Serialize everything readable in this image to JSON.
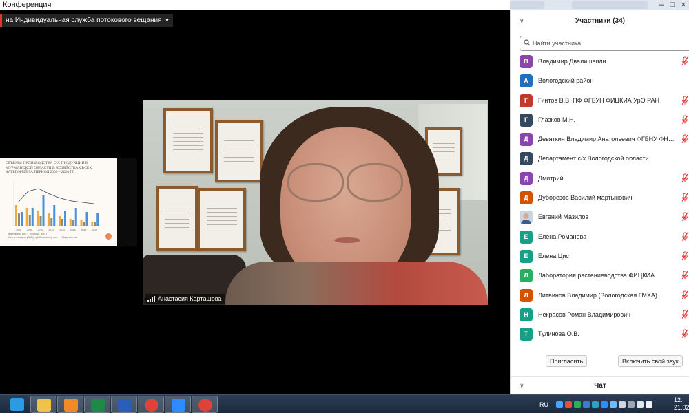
{
  "window": {
    "title": "Конференция",
    "controls": [
      "–",
      "□",
      "×"
    ]
  },
  "stream_banner": {
    "text": "на Индивидуальная служба потокового вещания",
    "caret": "▾"
  },
  "shared_slide": {
    "title": "Объемы производства с/х продукции в Мурманской области в хозяйствах всех категорий за период 2000 – 2020 гг.",
    "legend": [
      "Картофель, тыс. т",
      "Молоко, тыс. т",
      "Скот и птица на убой (в убойном весе), тыс. т",
      "Яйца, млн. шт."
    ],
    "x_labels": [
      "2000",
      "2005",
      "2010",
      "2012",
      "2014",
      "2016",
      "2018",
      "2020"
    ],
    "colors": {
      "potato": "#f2a93b",
      "milk": "#4a90d9",
      "meat": "#8a8a8a",
      "eggs": "#2c3e60"
    }
  },
  "main_video": {
    "participant_name": "Анастасия Карташова"
  },
  "participants": {
    "header_title": "Участники (34)",
    "search_placeholder": "Найти участника",
    "items": [
      {
        "initial": "В",
        "name": "Владимир Двалишвили",
        "color": "#8e44ad",
        "muted": true
      },
      {
        "initial": "А",
        "name": "Вологодский район",
        "color": "#1f6fbf",
        "muted": false
      },
      {
        "initial": "Г",
        "name": "Гинтов В.В.  ПФ ФГБУН ФИЦКИА УрО РАН",
        "color": "#c0392b",
        "muted": true
      },
      {
        "initial": "Г",
        "name": "Глазков М.Н.",
        "color": "#34495e",
        "muted": true
      },
      {
        "initial": "Д",
        "name": "Девяткин Владимир Анатольевич ФГБНУ ФНЦ ВИ...",
        "color": "#8e44ad",
        "muted": true
      },
      {
        "initial": "Д",
        "name": "Департамент с/х Вологодской области",
        "color": "#34495e",
        "muted": false
      },
      {
        "initial": "Д",
        "name": "Дмитрий",
        "color": "#8e44ad",
        "muted": true
      },
      {
        "initial": "Д",
        "name": "Дуборезов Василий мартынович",
        "color": "#d35400",
        "muted": true
      },
      {
        "initial": "",
        "name": "Евгений Мазилов",
        "color": "#dfe3e6",
        "muted": true,
        "photo": true
      },
      {
        "initial": "Е",
        "name": "Елена Романова",
        "color": "#16a085",
        "muted": true
      },
      {
        "initial": "Е",
        "name": "Елена Цис",
        "color": "#16a085",
        "muted": true
      },
      {
        "initial": "Л",
        "name": "Лаборатория растениеводства ФИЦКИА",
        "color": "#27ae60",
        "muted": true
      },
      {
        "initial": "Л",
        "name": "Литвинов Владимир (Вологодская ГМХА)",
        "color": "#d35400",
        "muted": true
      },
      {
        "initial": "Н",
        "name": "Некрасов Роман Владимирович",
        "color": "#16a085",
        "muted": true
      },
      {
        "initial": "Т",
        "name": "Тулинова О.В.",
        "color": "#16a085",
        "muted": true
      }
    ],
    "invite_label": "Пригласить",
    "unmute_label": "Включить свой звук",
    "mute_icon_color": "#e02f2f"
  },
  "chat": {
    "title": "Чат"
  },
  "taskbar": {
    "apps": [
      {
        "name": "internet-explorer",
        "color": "#2d9be0"
      },
      {
        "name": "file-explorer",
        "color": "#f0c348"
      },
      {
        "name": "media-player",
        "color": "#f08a24"
      },
      {
        "name": "excel",
        "color": "#1f8a45"
      },
      {
        "name": "word",
        "color": "#2b5eb8"
      },
      {
        "name": "chrome",
        "color": "#e0423a"
      },
      {
        "name": "zoom",
        "color": "#2d8cff"
      },
      {
        "name": "chrome",
        "color": "#e0423a"
      }
    ],
    "language": "RU",
    "time": "12:",
    "date": "21.02"
  }
}
